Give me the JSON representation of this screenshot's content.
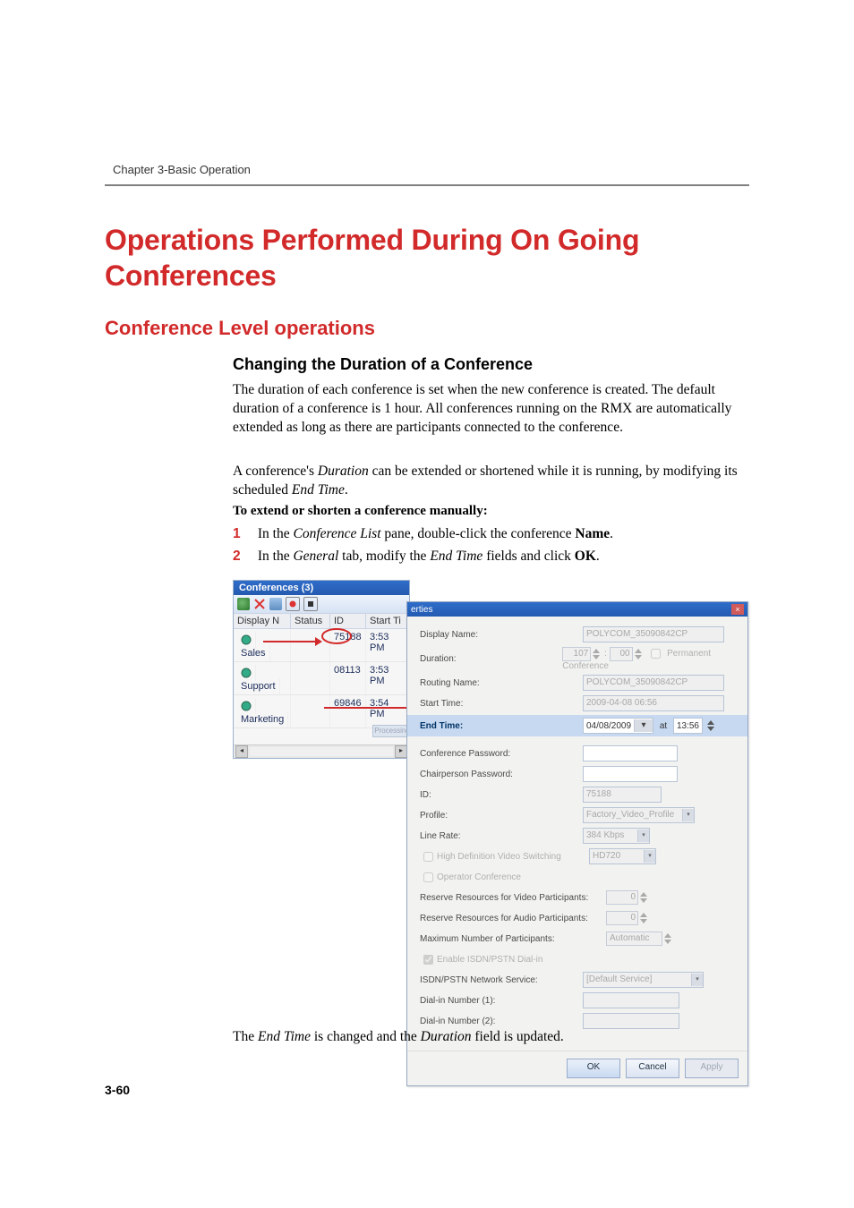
{
  "header": {
    "chapter": "Chapter 3-Basic Operation"
  },
  "h1": "Operations Performed During On Going Conferences",
  "h2": "Conference Level operations",
  "h3": "Changing the Duration of a Conference",
  "para1": "The duration of each conference is set when the new conference is created. The default duration of a conference is 1 hour. All conferences running on the RMX are automatically extended as long as there are participants connected to the conference.",
  "para2_prefix": "A conference's ",
  "para2_dur": "Duration",
  "para2_mid": " can be extended or shortened while it is running, by modifying its scheduled ",
  "para2_end": "End Time",
  "para2_suffix": ".",
  "bold_line": "To extend or shorten a conference manually:",
  "step1": {
    "num": "1",
    "pre": "In the ",
    "cl": "Conference List",
    "mid": " pane, double-click the conference ",
    "name": "Name",
    "post": "."
  },
  "step2": {
    "num": "2",
    "pre": "In the ",
    "gen": "General",
    "mid": " tab, modify the ",
    "et": "End Time",
    "mid2": " fields and click ",
    "ok": "OK",
    "post": "."
  },
  "conf_list": {
    "title": "Conferences (3)",
    "cols": {
      "c0": "Display N",
      "c1": "Status",
      "c2": "ID",
      "c3": "Start Ti"
    },
    "rows": [
      {
        "name": "Sales",
        "status": "",
        "id": "75188",
        "time": "3:53 PM"
      },
      {
        "name": "Support",
        "status": "",
        "id": "08113",
        "time": "3:53 PM"
      },
      {
        "name": "Marketing",
        "status": "",
        "id": "69846",
        "time": "3:54 PM"
      }
    ],
    "tabtext": "Processing"
  },
  "modal": {
    "title": "erties",
    "display_name": {
      "label": "Display Name:",
      "value": "POLYCOM_35090842CP"
    },
    "duration": {
      "label": "Duration:",
      "hh": "107",
      "mm": "00",
      "perm": "Permanent Conference"
    },
    "routing": {
      "label": "Routing Name:",
      "value": "POLYCOM_35090842CP"
    },
    "start_time": {
      "label": "Start Time:",
      "value": "2009-04-08 06:56"
    },
    "end_time": {
      "label": "End Time:",
      "date": "04/08/2009",
      "at": "at",
      "time": "13:56"
    },
    "conf_pw": {
      "label": "Conference Password:"
    },
    "chair_pw": {
      "label": "Chairperson Password:"
    },
    "id": {
      "label": "ID:",
      "value": "75188"
    },
    "profile": {
      "label": "Profile:",
      "value": "Factory_Video_Profile"
    },
    "line_rate": {
      "label": "Line Rate:",
      "value": "384 Kbps"
    },
    "hd": {
      "label": "High Definition Video Switching",
      "res": "HD720"
    },
    "op_conf": {
      "label": "Operator Conference"
    },
    "res_video": {
      "label": "Reserve Resources for Video Participants:",
      "value": "0"
    },
    "res_audio": {
      "label": "Reserve Resources for Audio Participants:",
      "value": "0"
    },
    "max_par": {
      "label": "Maximum Number of Participants:",
      "value": "Automatic"
    },
    "enable_isdn": {
      "label": "Enable ISDN/PSTN Dial-in"
    },
    "isdn_svc": {
      "label": "ISDN/PSTN Network Service:",
      "value": "[Default Service]"
    },
    "dial1": {
      "label": "Dial-in Number (1):"
    },
    "dial2": {
      "label": "Dial-in Number (2):"
    },
    "ok": "OK",
    "cancel": "Cancel",
    "apply": "Apply"
  },
  "final_pre": "The ",
  "final_et": "End Time",
  "final_mid": " is changed and the ",
  "final_dur": "Duration",
  "final_post": " field is updated.",
  "page_num": "3-60"
}
